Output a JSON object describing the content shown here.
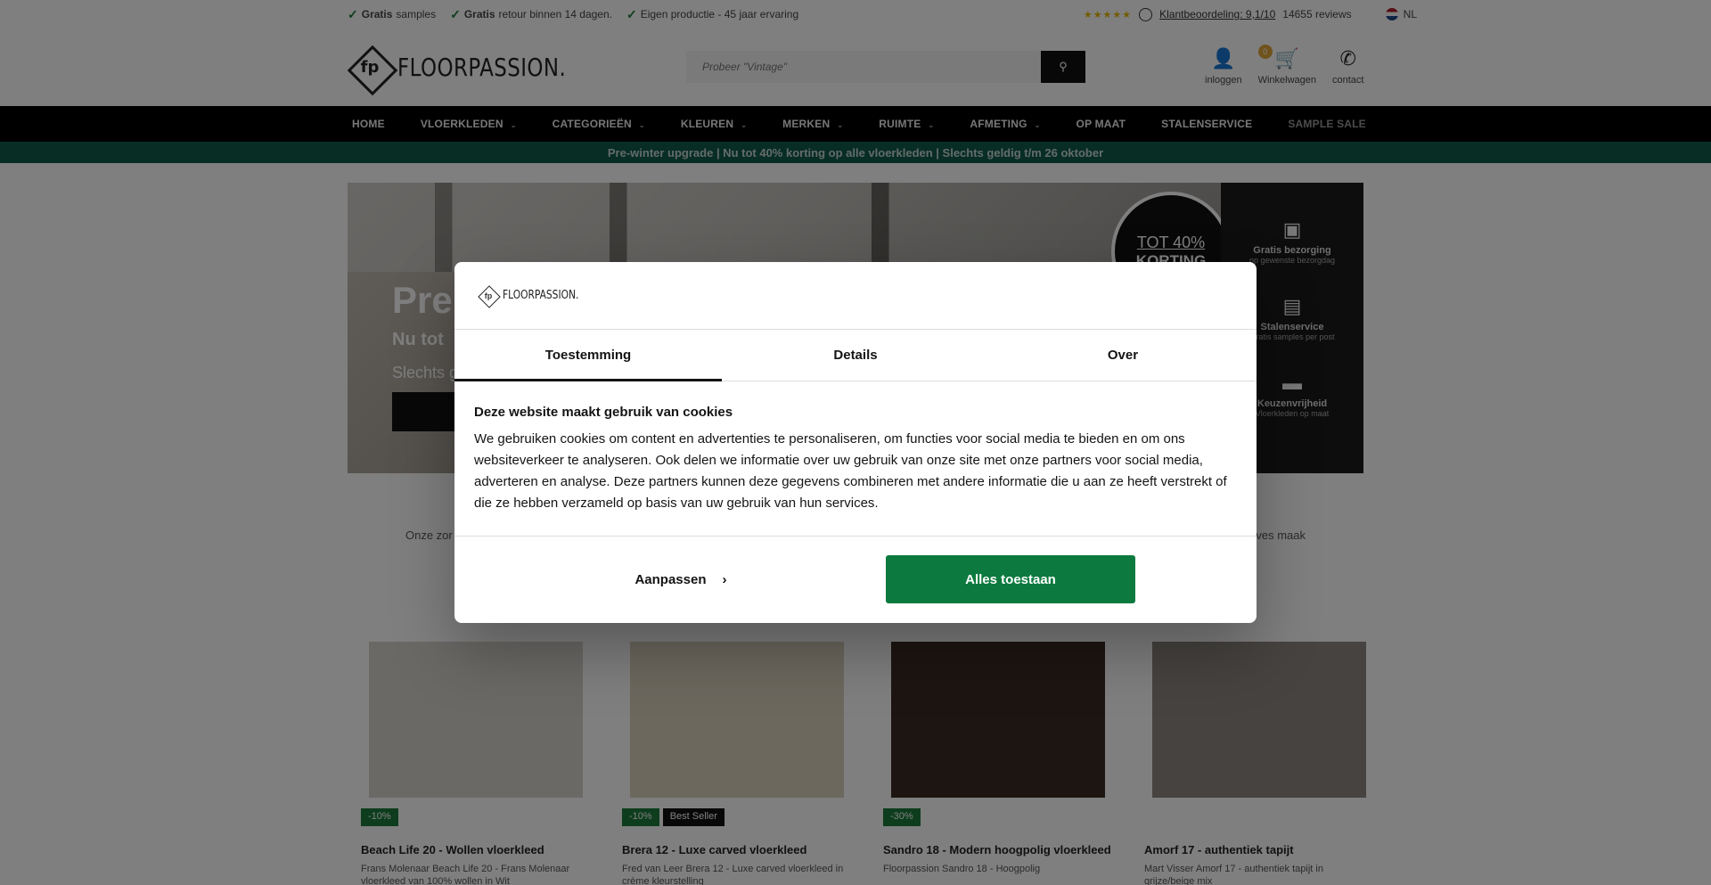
{
  "topbar": {
    "usps": [
      {
        "bold": "Gratis",
        "text": " samples"
      },
      {
        "bold": "Gratis",
        "text": " retour binnen 14 dagen."
      },
      {
        "bold": "",
        "text": "Eigen productie - 45 jaar ervaring"
      }
    ],
    "stars": "★★★★★",
    "rating_label": "Klantbeoordeling:",
    "rating_value": "9,1/10",
    "reviews": "14655 reviews",
    "language": "NL"
  },
  "header": {
    "logo_text": "FLOORPASSION.",
    "logo_mark": "fp",
    "search_placeholder": "Probeer \"Vintage\"",
    "login_label": "inloggen",
    "cart_label": "Winkelwagen",
    "cart_count": "0",
    "contact_label": "contact"
  },
  "nav": {
    "items": [
      {
        "label": "HOME",
        "dropdown": false
      },
      {
        "label": "VLOERKLEDEN",
        "dropdown": true
      },
      {
        "label": "CATEGORIEËN",
        "dropdown": true
      },
      {
        "label": "KLEUREN",
        "dropdown": true
      },
      {
        "label": "MERKEN",
        "dropdown": true
      },
      {
        "label": "RUIMTE",
        "dropdown": true
      },
      {
        "label": "AFMETING",
        "dropdown": true
      },
      {
        "label": "OP MAAT",
        "dropdown": false
      },
      {
        "label": "STALENSERVICE",
        "dropdown": false
      },
      {
        "label": "SAMPLE SALE",
        "dropdown": false
      }
    ]
  },
  "promo_text": "Pre-winter upgrade | Nu tot 40% korting op alle vloerkleden | Slechts geldig t/m 26 oktober",
  "hero": {
    "title": "Pre",
    "subtitle": "Nu tot",
    "small": "Slechts g",
    "badge_line1": "TOT 40%",
    "badge_line2": "KORTING",
    "side_usps": [
      {
        "icon": "box-icon",
        "title": "Gratis bezorging",
        "sub": "op gewenste bezorgdag"
      },
      {
        "icon": "swatch-icon",
        "title": "Stalenservice",
        "sub": "Gratis samples per post"
      },
      {
        "icon": "ruler-icon",
        "title": "Keuzenvrijheid",
        "sub": "Vloerkleden op maat"
      }
    ]
  },
  "intro": {
    "left": "Onze zor",
    "right": "ves maak"
  },
  "products": [
    {
      "name": "Beach Life 20 - Wollen vloerkleed",
      "desc": "Frans Molenaar Beach Life 20 - Frans Molenaar vloerkleed van 100% wollen in Wit",
      "badges": [
        "-10%"
      ],
      "color": "#d7d3cc"
    },
    {
      "name": "Brera 12 - Luxe carved vloerkleed",
      "desc": "Fred van Leer Brera 12 - Luxe carved vloerkleed in crème kleurstelling",
      "badges": [
        "-10%",
        "Best Seller"
      ],
      "color": "#d9d0bc"
    },
    {
      "name": "Sandro 18 - Modern hoogpolig vloerkleed",
      "desc": "Floorpassion Sandro 18 - Hoogpolig",
      "badges": [
        "-30%"
      ],
      "color": "#3a2a23"
    },
    {
      "name": "Amorf 17 - authentiek tapijt",
      "desc": "Mart Visser Amorf 17 - authentiek tapijt in grijze/beige mix",
      "badges": [],
      "color": "#8c8780"
    }
  ],
  "cookie": {
    "logo_text": "FLOORPASSION.",
    "tabs": [
      "Toestemming",
      "Details",
      "Over"
    ],
    "title": "Deze website maakt gebruik van cookies",
    "text": "We gebruiken cookies om content en advertenties te personaliseren, om functies voor social media te bieden en om ons websiteverkeer te analyseren. Ook delen we informatie over uw gebruik van onze site met onze partners voor social media, adverteren en analyse. Deze partners kunnen deze gegevens combineren met andere informatie die u aan ze heeft verstrekt of die ze hebben verzameld op basis van uw gebruik van hun services.",
    "customize_label": "Aanpassen",
    "allow_label": "Alles toestaan"
  }
}
